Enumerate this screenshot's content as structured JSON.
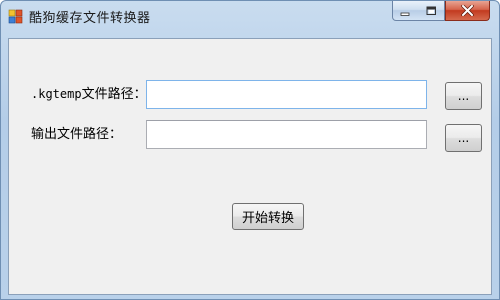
{
  "window": {
    "title": "酷狗缓存文件转换器",
    "app_icon": "app-blocks-icon",
    "controls": {
      "minimize": "minimize-icon",
      "maximize": "maximize-icon",
      "close": "close-icon"
    }
  },
  "form": {
    "kgtemp_label_prefix": ".kgtemp",
    "kgtemp_label_suffix": "文件路径：",
    "kgtemp_value": "",
    "output_label": "输出文件路径：",
    "output_value": "",
    "browse_label": "...",
    "convert_label": "开始转换"
  },
  "colors": {
    "close_button": "#c94a2e",
    "focus_border": "#7eb4ea"
  }
}
